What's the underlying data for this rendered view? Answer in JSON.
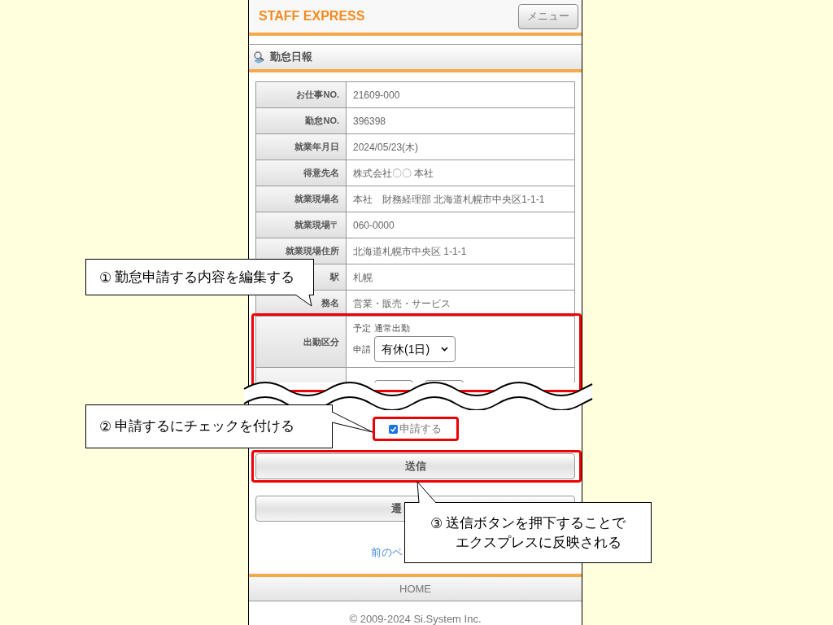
{
  "header": {
    "logo": "STAFF EXPRESS",
    "menu_button": "メニュー"
  },
  "page_title": "勤怠日報",
  "rows": [
    {
      "label": "お仕事NO.",
      "value": "21609-000"
    },
    {
      "label": "勤怠NO.",
      "value": "396398"
    },
    {
      "label": "就業年月日",
      "value": "2024/05/23(木)"
    },
    {
      "label": "得意先名",
      "value": "株式会社〇〇 本社"
    },
    {
      "label": "就業現場名",
      "value": "本社　財務経理部 北海道札幌市中央区1-1-1"
    },
    {
      "label": "就業現場〒",
      "value": "060-0000"
    },
    {
      "label": "就業現場住所",
      "value": "北海道札幌市中央区 1-1-1"
    },
    {
      "label": "駅",
      "value": "札幌"
    },
    {
      "label": "務名",
      "value": "営業・販売・サービス"
    }
  ],
  "attendance": {
    "label": "出勤区分",
    "planned_label": "予定",
    "planned_value": "通常出勤",
    "request_label": "申請",
    "select_value": "有休(1日)"
  },
  "apply_checkbox": {
    "label": "申請する",
    "checked": true
  },
  "submit_button": "送信",
  "second_button": "遷",
  "back_link": "前のペ",
  "footer": {
    "home": "HOME",
    "copyright": "© 2009-2024 Si.System Inc."
  },
  "callouts": [
    {
      "marker": "①",
      "lines": [
        "勤怠申請する内容を編集する"
      ]
    },
    {
      "marker": "②",
      "lines": [
        "申請するにチェックを付ける"
      ]
    },
    {
      "marker": "③",
      "lines": [
        "送信ボタンを押下することで",
        "エクスプレスに反映される"
      ]
    }
  ]
}
